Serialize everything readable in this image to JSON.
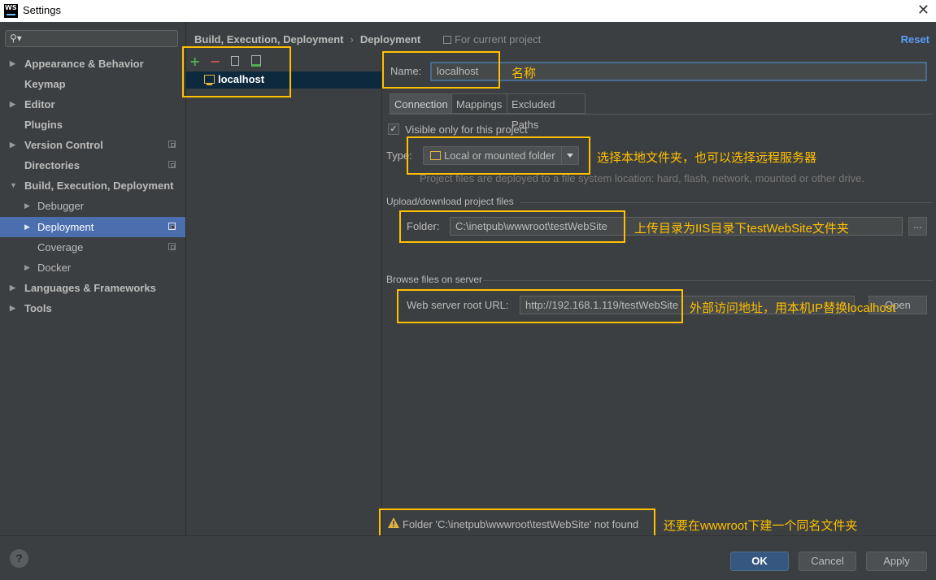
{
  "window": {
    "title": "Settings",
    "logo_text": "WS",
    "close_glyph": "✕"
  },
  "search": {
    "placeholder": "",
    "icon": "search-icon"
  },
  "sidebar": {
    "items": [
      {
        "label": "Appearance & Behavior",
        "arrow": "▶"
      },
      {
        "label": "Keymap"
      },
      {
        "label": "Editor",
        "arrow": "▶"
      },
      {
        "label": "Plugins"
      },
      {
        "label": "Version Control",
        "arrow": "▶"
      },
      {
        "label": "Directories"
      },
      {
        "label": "Build, Execution, Deployment",
        "arrow": "▼"
      },
      {
        "label": "Debugger",
        "arrow": "▶"
      },
      {
        "label": "Deployment",
        "arrow": "▶"
      },
      {
        "label": "Coverage"
      },
      {
        "label": "Docker",
        "arrow": "▶"
      },
      {
        "label": "Languages & Frameworks",
        "arrow": "▶"
      },
      {
        "label": "Tools",
        "arrow": "▶"
      }
    ]
  },
  "header": {
    "breadcrumb_parent": "Build, Execution, Deployment",
    "breadcrumb_sep": "›",
    "breadcrumb_current": "Deployment",
    "scope": "For current project",
    "reset": "Reset"
  },
  "servers": {
    "toolbar": {
      "add": "+",
      "remove": "−"
    },
    "items": [
      {
        "label": "localhost"
      }
    ]
  },
  "form": {
    "name_label": "Name:",
    "name_value": "localhost",
    "tabs": [
      {
        "label": "Connection"
      },
      {
        "label": "Mappings"
      },
      {
        "label": "Excluded Paths"
      }
    ],
    "visible_only": "Visible only for this project",
    "checkbox_glyph": "✓",
    "type_label": "Type:",
    "type_value": "Local or mounted folder",
    "type_hint": "Project files are deployed to a file system location: hard, flash, network, mounted or other drive.",
    "upload_section": "Upload/download project files",
    "folder_label": "Folder:",
    "folder_value": "C:\\inetpub\\wwwroot\\testWebSite",
    "browse_button": "...",
    "browse_section": "Browse files on server",
    "web_root_label": "Web server root URL:",
    "web_root_value": "http://192.168.1.119/testWebSite",
    "open_button": "Open",
    "warning": "Folder 'C:\\inetpub\\wwwroot\\testWebSite' not found"
  },
  "annotations": {
    "name": "名称",
    "type": "选择本地文件夹，也可以选择远程服务器",
    "folder": "上传目录为IIS目录下testWebSite文件夹",
    "url": "外部访问地址，用本机IP替换localhost",
    "warning": "还要在wwwroot下建一个同名文件夹"
  },
  "footer": {
    "help": "?",
    "ok": "OK",
    "cancel": "Cancel",
    "apply": "Apply"
  },
  "colors": {
    "accent": "#4b6eaf",
    "annotation": "#ffc000",
    "link": "#589df6"
  }
}
